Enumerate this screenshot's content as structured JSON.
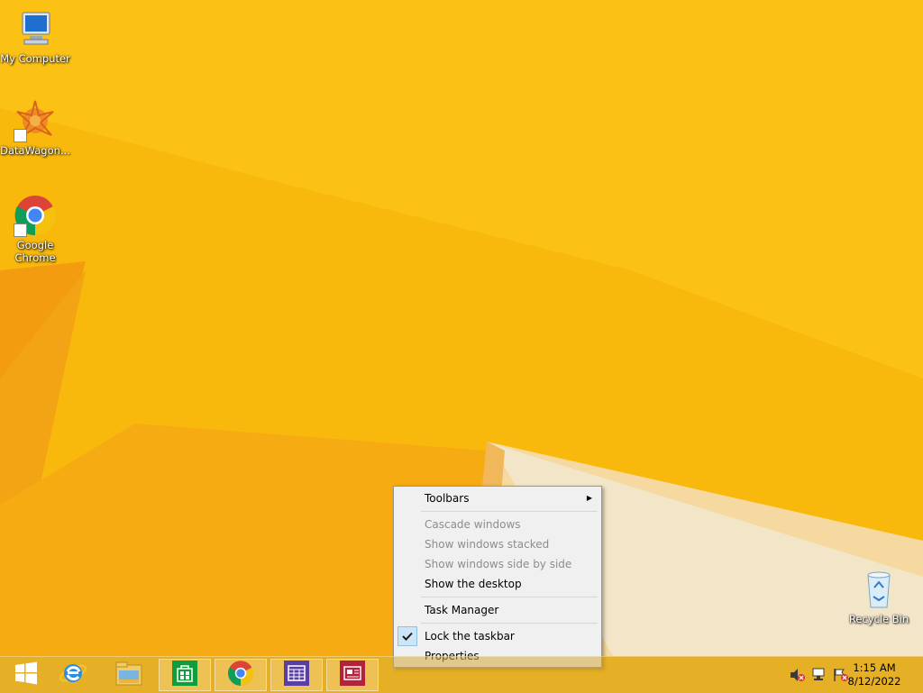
{
  "desktop": {
    "icons": [
      {
        "label": "My Computer",
        "icon": "computer-icon"
      },
      {
        "label": "DataWagon...",
        "icon": "datawagon-icon"
      },
      {
        "label": "Google Chrome",
        "icon": "chrome-icon"
      },
      {
        "label": "Recycle Bin",
        "icon": "recycle-bin-icon"
      }
    ]
  },
  "context_menu": {
    "items": [
      {
        "label": "Toolbars",
        "enabled": true,
        "has_submenu": true
      },
      {
        "label": "Cascade windows",
        "enabled": false
      },
      {
        "label": "Show windows stacked",
        "enabled": false
      },
      {
        "label": "Show windows side by side",
        "enabled": false
      },
      {
        "label": "Show the desktop",
        "enabled": true
      },
      {
        "label": "Task Manager",
        "enabled": true
      },
      {
        "label": "Lock the taskbar",
        "enabled": true,
        "checked": true
      },
      {
        "label": "Properties",
        "enabled": true
      }
    ]
  },
  "taskbar": {
    "buttons": [
      {
        "icon": "windows-start-icon"
      },
      {
        "icon": "internet-explorer-icon"
      },
      {
        "icon": "file-explorer-icon"
      },
      {
        "icon": "store-icon"
      },
      {
        "icon": "chrome-icon"
      },
      {
        "icon": "calendar-app-icon"
      },
      {
        "icon": "news-app-icon"
      }
    ],
    "tray": {
      "icons": [
        "volume-muted-icon",
        "network-icon",
        "action-center-flag-icon"
      ],
      "time": "1:15 AM",
      "date": "8/12/2022"
    }
  },
  "colors": {
    "wallpaper": "#f8b90c",
    "menu_bg": "#f0f0f0",
    "check_highlight": "#cde6f7"
  }
}
